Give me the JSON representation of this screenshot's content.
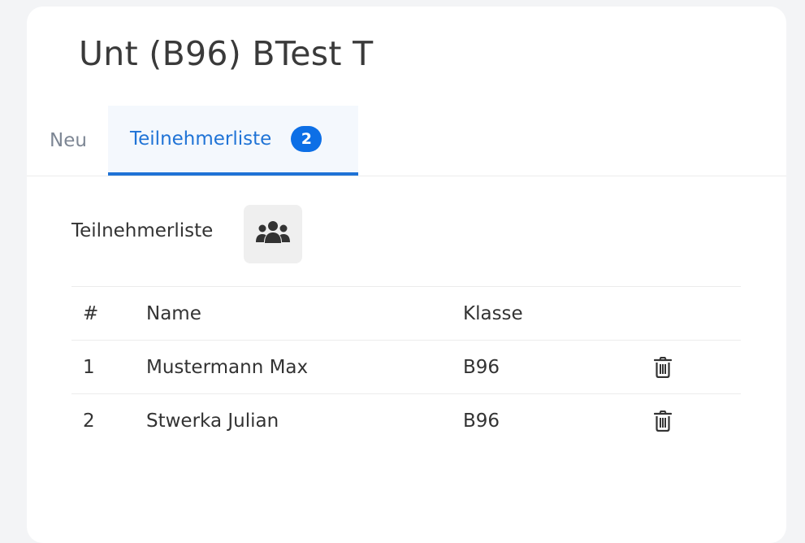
{
  "course": {
    "title": "Unt (B96) BTest T"
  },
  "tabs": [
    {
      "label": "Neu",
      "active": false
    },
    {
      "label": "Teilnehmerliste",
      "active": true,
      "badge": "2"
    }
  ],
  "participants_section": {
    "label": "Teilnehmerliste",
    "icon": "users-group-icon"
  },
  "table": {
    "headers": {
      "num": "#",
      "name": "Name",
      "klasse": "Klasse"
    },
    "rows": [
      {
        "num": "1",
        "name": "Mustermann Max",
        "klasse": "B96",
        "action_icon": "trash-icon"
      },
      {
        "num": "2",
        "name": "Stwerka Julian",
        "klasse": "B96",
        "action_icon": "trash-icon"
      }
    ]
  },
  "colors": {
    "accent": "#1f73d6",
    "badge": "#0d6fe6",
    "background": "#f3f4f6",
    "card": "#ffffff",
    "text": "#333333"
  }
}
